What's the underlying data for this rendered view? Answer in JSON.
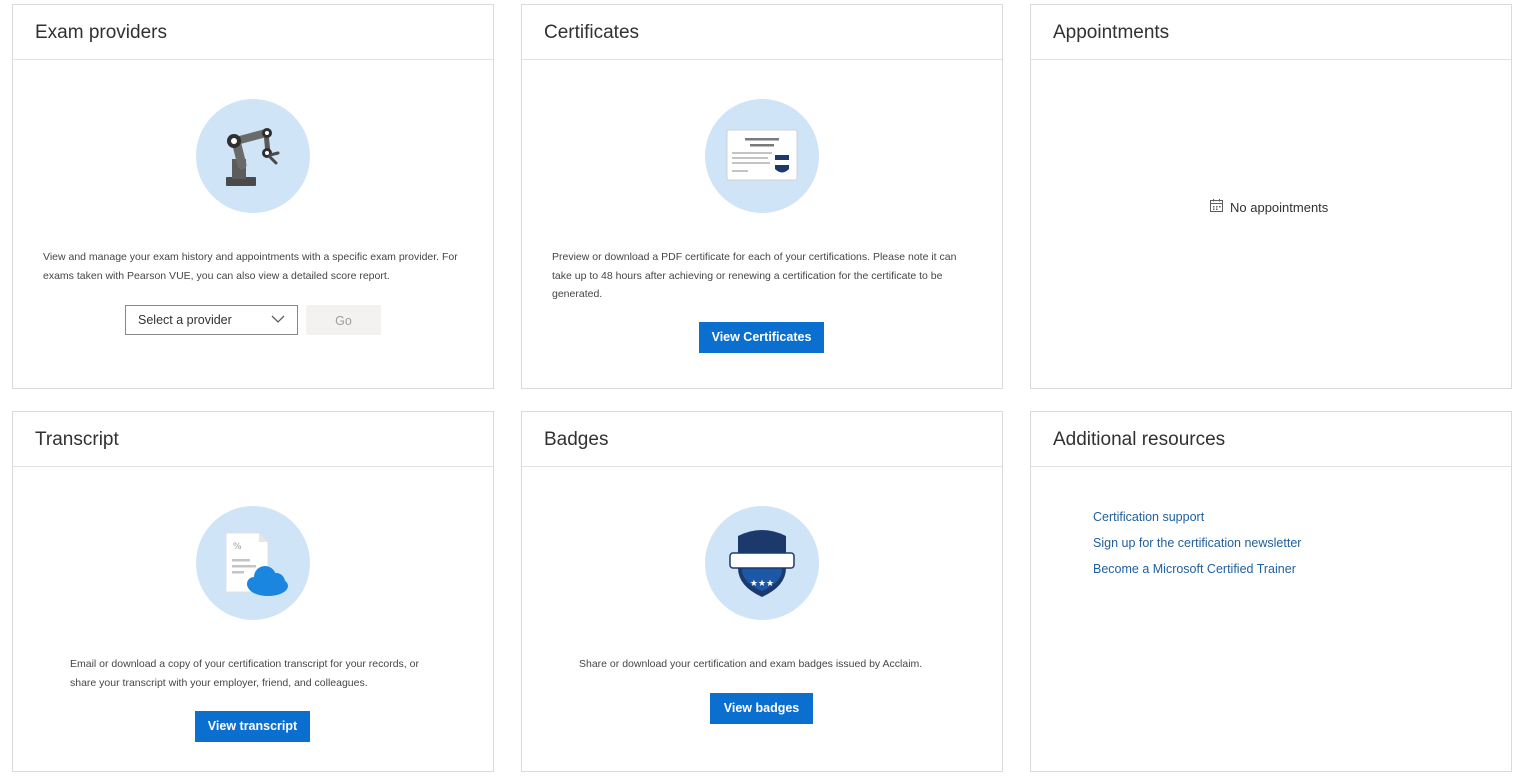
{
  "exam_providers": {
    "title": "Exam providers",
    "description_line1": "View and manage your exam history and appointments with a specific exam provider. For",
    "description_line2": "exams taken with Pearson VUE, you can also view a detailed score report.",
    "select_value": "Select a provider",
    "go_label": "Go",
    "icon": "robot-arm-icon"
  },
  "certificates": {
    "title": "Certificates",
    "description_line1": "Preview or download a PDF certificate for each of your certifications. Please note it can",
    "description_line2": "take up to 48 hours after achieving or renewing a certification for the certificate to be",
    "description_line3": "generated.",
    "button_label": "View Certificates",
    "icon": "certificate-icon"
  },
  "appointments": {
    "title": "Appointments",
    "empty_text": "No appointments",
    "icon": "calendar-icon"
  },
  "transcript": {
    "title": "Transcript",
    "description_line1": "Email or download a copy of your certification transcript for your records, or",
    "description_line2": "share your transcript with your employer, friend, and colleagues.",
    "button_label": "View transcript",
    "icon": "transcript-cloud-icon"
  },
  "badges": {
    "title": "Badges",
    "description_line1": "Share or download your certification and exam badges issued by Acclaim.",
    "button_label": "View badges",
    "icon": "badge-shield-icon"
  },
  "additional_resources": {
    "title": "Additional resources",
    "links": [
      "Certification support",
      "Sign up for the certification newsletter",
      "Become a Microsoft Certified Trainer"
    ]
  },
  "colors": {
    "primary_button": "#0b6fd0",
    "link": "#1f5f9e",
    "illustration_bg": "#cfe4f6",
    "border": "#dadada"
  }
}
